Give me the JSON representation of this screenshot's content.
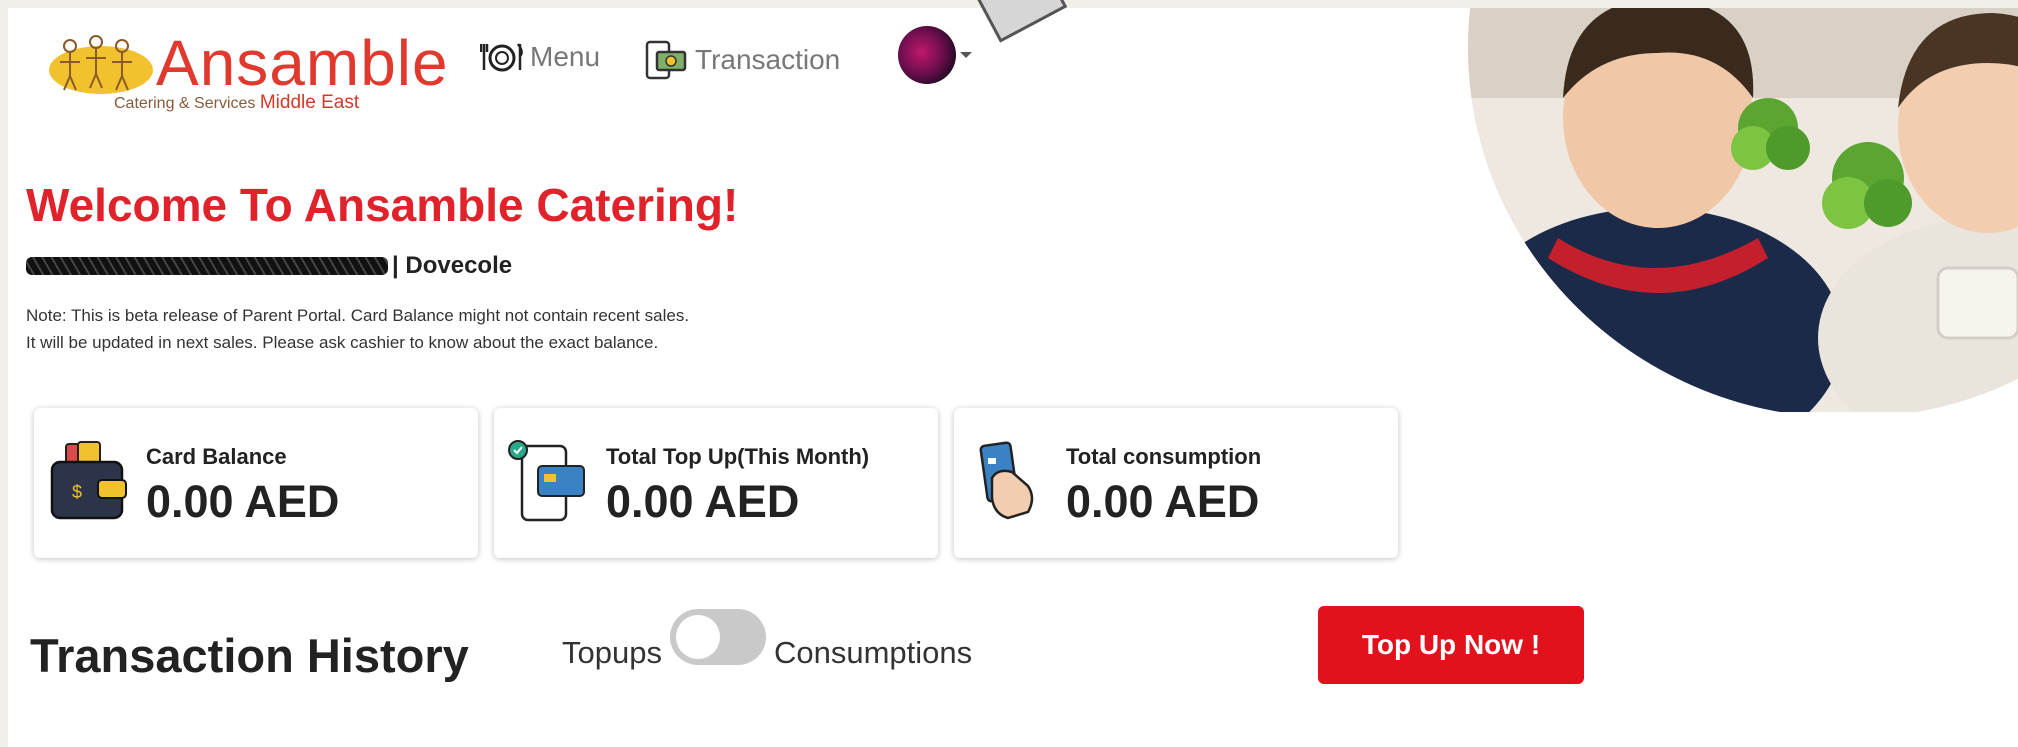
{
  "brand": {
    "name": "Ansamble",
    "tagline": "Catering & Services",
    "tagline_region": "Middle East"
  },
  "nav": {
    "menu_label": "Menu",
    "transaction_label": "Transaction"
  },
  "welcome": {
    "title": "Welcome To Ansamble Catering!",
    "school": "| Dovecole",
    "note_line1": "Note: This is beta release of Parent Portal. Card Balance might not contain recent sales.",
    "note_line2": "It will be updated in next sales. Please ask cashier to know about the exact balance."
  },
  "cards": [
    {
      "label": "Card Balance",
      "value": "0.00 AED",
      "icon": "wallet-icon"
    },
    {
      "label": "Total Top Up(This Month)",
      "value": "0.00 AED",
      "icon": "mobile-topup-icon"
    },
    {
      "label": "Total consumption",
      "value": "0.00 AED",
      "icon": "card-payment-icon"
    }
  ],
  "history": {
    "title": "Transaction History",
    "toggle_left": "Topups",
    "toggle_right": "Consumptions",
    "topup_button": "Top Up Now !"
  },
  "colors": {
    "brand_red": "#e0232b",
    "button_red": "#e2121c"
  }
}
